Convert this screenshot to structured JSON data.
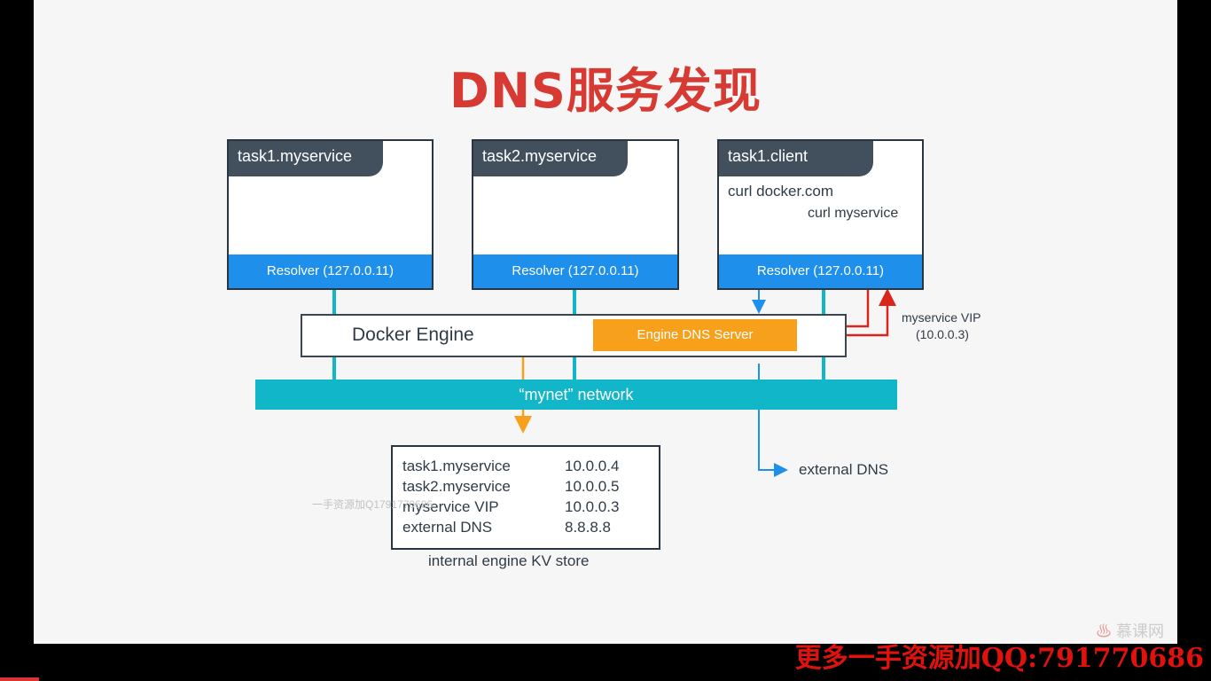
{
  "title": "DNS服务发现",
  "containers": [
    {
      "name": "task1.myservice",
      "resolver": "Resolver (127.0.0.11)"
    },
    {
      "name": "task2.myservice",
      "resolver": "Resolver (127.0.0.11)"
    },
    {
      "name": "task1.client",
      "resolver": "Resolver (127.0.0.11)"
    }
  ],
  "client_labels": {
    "curl_docker": "curl docker.com",
    "curl_myservice": "curl myservice"
  },
  "engine": {
    "label": "Docker Engine",
    "dns_server": "Engine DNS Server"
  },
  "vip": {
    "line1": "myservice VIP",
    "line2": "(10.0.0.3)"
  },
  "network": "“mynet” network",
  "external_dns": "external DNS",
  "kv_store": {
    "caption": "internal engine KV store",
    "rows": [
      {
        "key": "task1.myservice",
        "value": "10.0.0.4"
      },
      {
        "key": "task2.myservice",
        "value": "10.0.0.5"
      },
      {
        "key": "myservice VIP",
        "value": "10.0.0.3"
      },
      {
        "key": "external DNS",
        "value": "8.8.8.8"
      }
    ]
  },
  "watermark": "一手资源加Q1791770686",
  "brand": "慕课网",
  "promo": "更多一手资源加QQ:791770686",
  "colors": {
    "title": "#d63a32",
    "resolver": "#1e90ec",
    "dns_server": "#f6a01b",
    "network": "#11b6c8",
    "red_arrow": "#d9261c",
    "blue_arrow": "#1e90ec",
    "orange_arrow": "#f6a01b",
    "promo": "#e0120d"
  }
}
